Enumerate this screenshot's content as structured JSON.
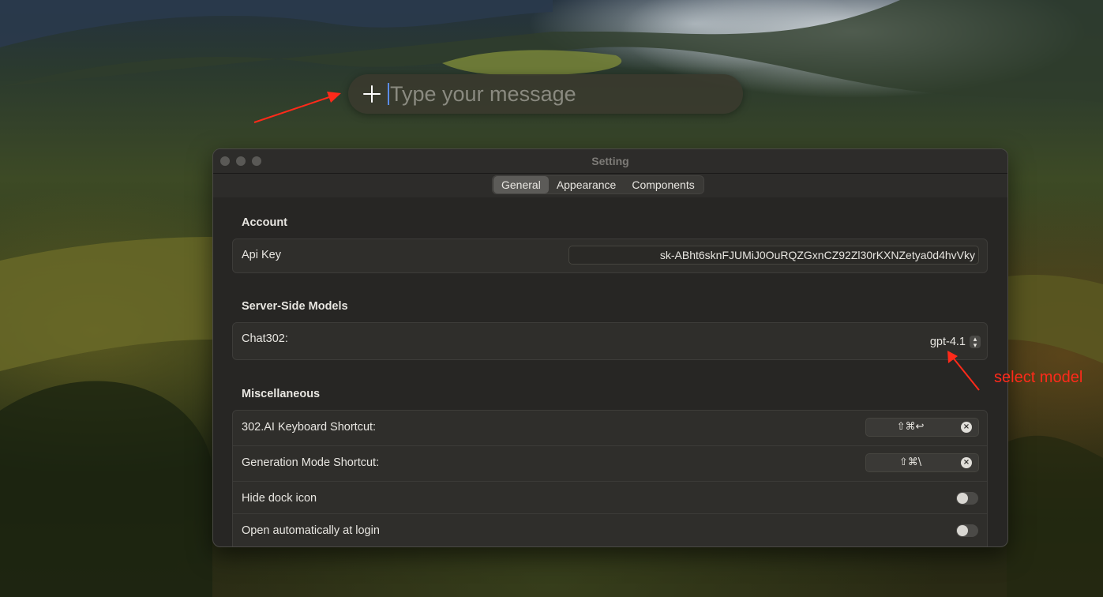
{
  "message_bar": {
    "placeholder": "Type your message",
    "add_icon": "plus-icon"
  },
  "window": {
    "title": "Setting",
    "tabs": [
      {
        "label": "General",
        "active": true
      },
      {
        "label": "Appearance",
        "active": false
      },
      {
        "label": "Components",
        "active": false
      }
    ]
  },
  "account": {
    "heading": "Account",
    "api_key_label": "Api Key",
    "api_key_value": "sk-ABht6sknFJUMiJ0OuRQZGxnCZ92Zl30rKXNZetya0d4hvVky"
  },
  "models": {
    "heading": "Server-Side Models",
    "chat_label": "Chat302:",
    "selected_model": "gpt-4.1"
  },
  "misc": {
    "heading": "Miscellaneous",
    "keyboard_shortcut_label": "302.AI Keyboard Shortcut:",
    "keyboard_shortcut_keys": "⇧⌘↩",
    "generation_shortcut_label": "Generation Mode Shortcut:",
    "generation_shortcut_keys": "⇧⌘\\",
    "hide_dock_label": "Hide dock icon",
    "hide_dock_on": false,
    "open_login_label": "Open automatically at login",
    "open_login_on": false
  },
  "annotations": {
    "select_model": "select model",
    "color": "#ff2a1a"
  }
}
